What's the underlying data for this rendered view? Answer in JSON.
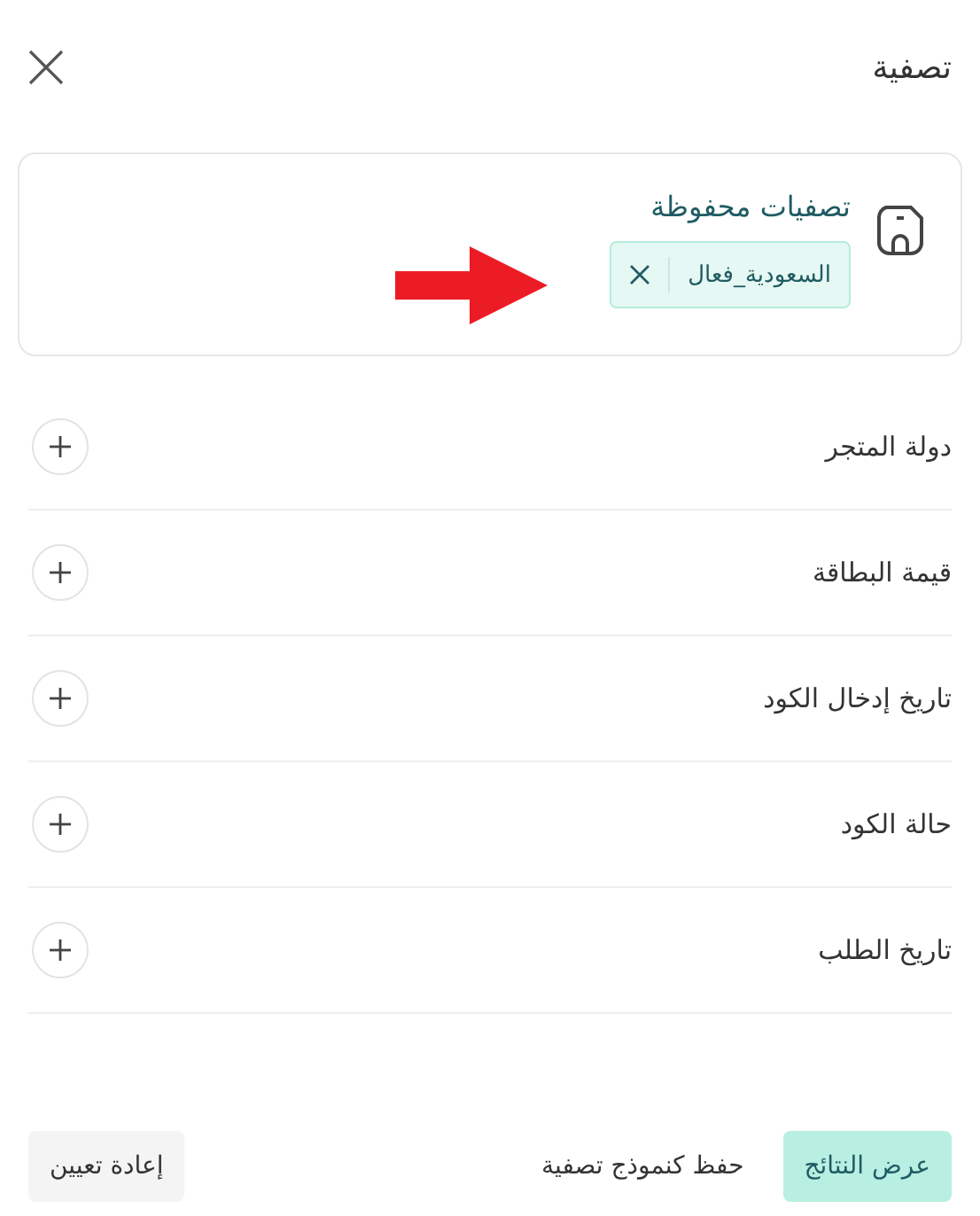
{
  "header": {
    "title": "تصفية"
  },
  "saved_filters": {
    "title": "تصفيات محفوظة",
    "chips": [
      {
        "label": "السعودية_فعال"
      }
    ]
  },
  "sections": [
    {
      "label": "دولة المتجر",
      "expanded": false
    },
    {
      "label": "قيمة البطاقة",
      "expanded": false
    },
    {
      "label": "تاريخ إدخال الكود",
      "expanded": false
    },
    {
      "label": "حالة الكود",
      "expanded": false
    },
    {
      "label": "تاريخ الطلب",
      "expanded": false
    }
  ],
  "footer": [
    {
      "label": "عرض النتائج",
      "kind": "primary"
    },
    {
      "label": "حفظ كنموذج تصفية",
      "kind": "text"
    },
    {
      "label": "إعادة تعيين",
      "kind": "secondary"
    }
  ]
}
